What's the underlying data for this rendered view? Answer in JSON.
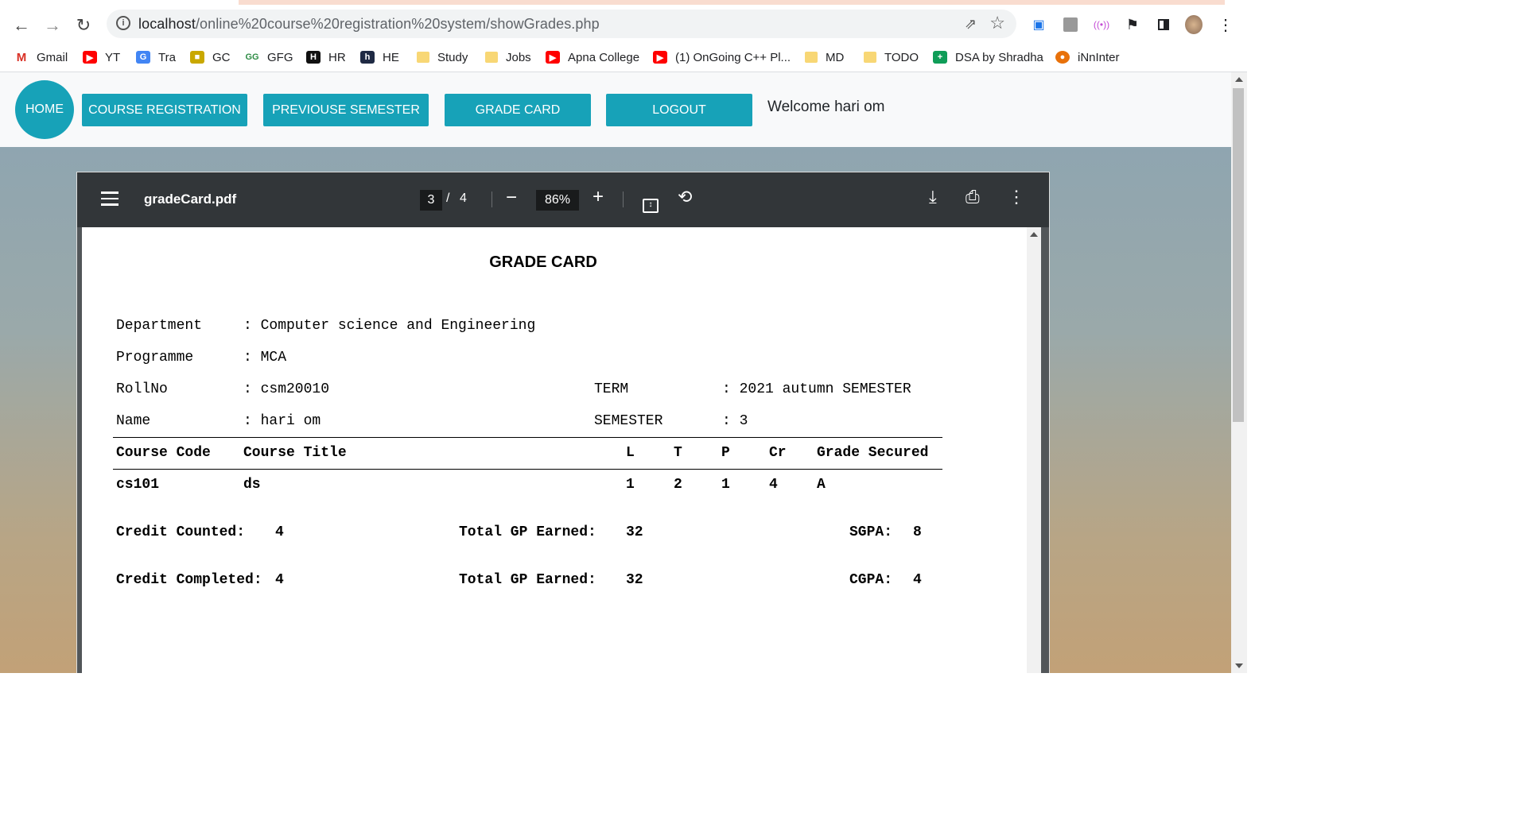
{
  "browser": {
    "url_host": "localhost",
    "url_path": "/online%20course%20registration%20system/showGrades.php",
    "bookmarks": [
      {
        "label": "Gmail"
      },
      {
        "label": "YT"
      },
      {
        "label": "Tra"
      },
      {
        "label": "GC"
      },
      {
        "label": "GFG"
      },
      {
        "label": "HR"
      },
      {
        "label": "HE"
      },
      {
        "label": "Study"
      },
      {
        "label": "Jobs"
      },
      {
        "label": "Apna College"
      },
      {
        "label": "(1) OnGoing C++ Pl..."
      },
      {
        "label": "MD"
      },
      {
        "label": "TODO"
      },
      {
        "label": "DSA by Shradha"
      },
      {
        "label": "iNnInter"
      }
    ]
  },
  "nav": {
    "home": "HOME",
    "course_registration": "COURSE REGISTRATION",
    "previous_semester": "PREVIOUSE SEMESTER",
    "grade_card": "GRADE CARD",
    "logout": "LOGOUT",
    "welcome": "Welcome hari om"
  },
  "pdf": {
    "filename": "gradeCard.pdf",
    "current_page": "3",
    "page_sep": "/",
    "total_pages": "4",
    "zoom": "86%"
  },
  "gradecard": {
    "title": "GRADE CARD",
    "department_label": "Department",
    "department_value": ": Computer science and Engineering",
    "programme_label": "Programme",
    "programme_value": ": MCA",
    "rollno_label": "RollNo",
    "rollno_value": ": csm20010",
    "term_label": "TERM",
    "term_value": ": 2021 autumn SEMESTER",
    "name_label": "Name",
    "name_value": ": hari om",
    "semester_label": "SEMESTER",
    "semester_value": ": 3",
    "headers": {
      "code": "Course Code",
      "title": "Course Title",
      "l": "L",
      "t": "T",
      "p": "P",
      "cr": "Cr",
      "grade": "Grade Secured"
    },
    "rows": [
      {
        "code": "cs101",
        "title": "ds",
        "l": "1",
        "t": "2",
        "p": "1",
        "cr": "4",
        "grade": "A"
      }
    ],
    "credit_counted_label": "Credit Counted:",
    "credit_counted_value": "4",
    "gp_earned_label_1": "Total GP Earned:",
    "gp_earned_value_1": "32",
    "sgpa_label": "SGPA:",
    "sgpa_value": "8",
    "credit_completed_label": "Credit Completed:",
    "credit_completed_value": "4",
    "gp_earned_label_2": "Total GP Earned:",
    "gp_earned_value_2": "32",
    "cgpa_label": "CGPA:",
    "cgpa_value": "4"
  }
}
